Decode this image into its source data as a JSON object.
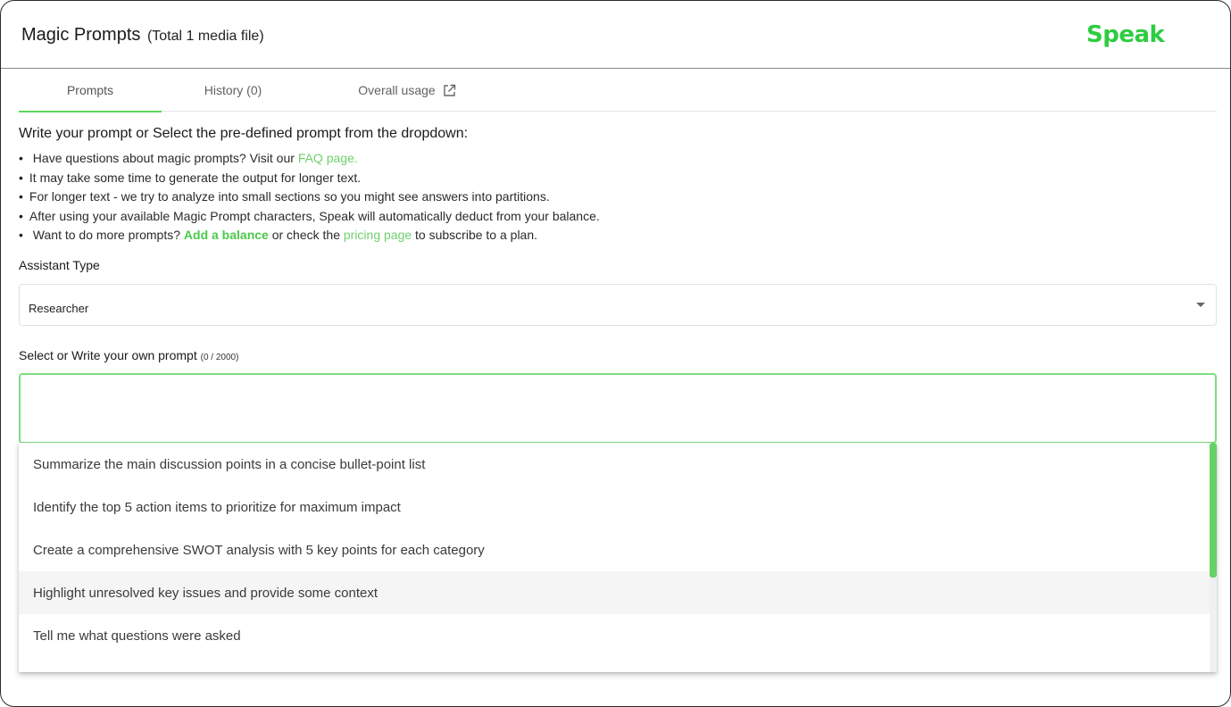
{
  "header": {
    "title": "Magic Prompts",
    "subtitle": "(Total 1 media file)",
    "logo": "Speak"
  },
  "tabs": [
    {
      "label": "Prompts",
      "active": true
    },
    {
      "label": "History (0)",
      "active": false
    },
    {
      "label": "Overall usage",
      "active": false,
      "icon": "external-link-icon"
    }
  ],
  "instructions": {
    "title": "Write your prompt or Select the pre-defined prompt from the dropdown:",
    "b1_text": "Have questions about magic prompts? Visit our",
    "b1_link": "FAQ page.",
    "b2": "It may take some time to generate the output for longer text.",
    "b3": "For longer text - we try to analyze into small sections so you might see answers into partitions.",
    "b4": "After using your available Magic Prompt characters, Speak will automatically deduct from your balance.",
    "b5_pre": "Want to do more prompts?",
    "b5_link1": "Add a balance",
    "b5_mid": "or check the",
    "b5_link2": "pricing page",
    "b5_post": "to subscribe to a plan."
  },
  "assistant": {
    "label": "Assistant Type",
    "value": "Researcher"
  },
  "prompt": {
    "label": "Select or Write your own prompt",
    "counter": "(0 / 2000)",
    "value": ""
  },
  "options": [
    "Summarize the main discussion points in a concise bullet-point list",
    "Identify the top 5 action items to prioritize for maximum impact",
    "Create a comprehensive SWOT analysis with 5 key points for each category",
    "Highlight unresolved key issues and provide some context",
    "Tell me what questions were asked"
  ],
  "colors": {
    "brand": "#2ecc40",
    "accent": "#5cd65c",
    "link": "#6fd06f"
  }
}
